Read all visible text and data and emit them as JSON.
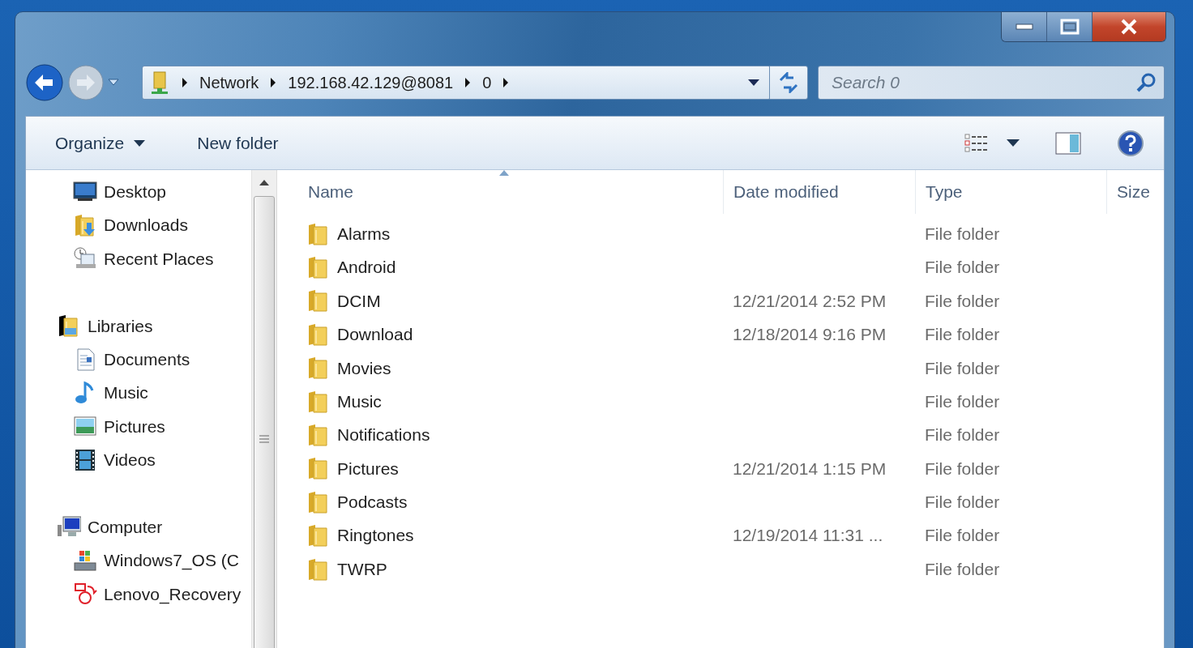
{
  "address_bar": {
    "segments": [
      "Network",
      "192.168.42.129@8081",
      "0"
    ]
  },
  "search": {
    "placeholder": "Search 0"
  },
  "toolbar": {
    "buttons": [
      {
        "label": "Organize",
        "dropdown": true
      },
      {
        "label": "New folder",
        "dropdown": false
      }
    ]
  },
  "nav_tree": [
    {
      "children": [
        {
          "label": "Desktop"
        },
        {
          "label": "Downloads"
        },
        {
          "label": "Recent Places"
        }
      ]
    },
    {
      "label": "Libraries",
      "children": [
        {
          "label": "Documents"
        },
        {
          "label": "Music"
        },
        {
          "label": "Pictures"
        },
        {
          "label": "Videos"
        }
      ]
    },
    {
      "label": "Computer",
      "children": [
        {
          "label": "Windows7_OS (C"
        },
        {
          "label": "Lenovo_Recovery"
        }
      ]
    }
  ],
  "table": {
    "columns": [
      {
        "label": "Name",
        "sorted": true
      },
      {
        "label": "Date modified",
        "sorted": false
      },
      {
        "label": "Type",
        "sorted": false
      },
      {
        "label": "Size",
        "sorted": false
      }
    ],
    "rows": [
      {
        "name": "Alarms",
        "type": "File folder"
      },
      {
        "name": "Android",
        "type": "File folder"
      },
      {
        "name": "DCIM",
        "date": "12/21/2014 2:52 PM",
        "type": "File folder"
      },
      {
        "name": "Download",
        "date": "12/18/2014 9:16 PM",
        "type": "File folder"
      },
      {
        "name": "Movies",
        "type": "File folder"
      },
      {
        "name": "Music",
        "type": "File folder"
      },
      {
        "name": "Notifications",
        "type": "File folder"
      },
      {
        "name": "Pictures",
        "date": "12/21/2014 1:15 PM",
        "type": "File folder"
      },
      {
        "name": "Podcasts",
        "type": "File folder"
      },
      {
        "name": "Ringtones",
        "date": "12/19/2014 11:31 ...",
        "type": "File folder"
      },
      {
        "name": "TWRP",
        "type": "File folder"
      }
    ]
  }
}
